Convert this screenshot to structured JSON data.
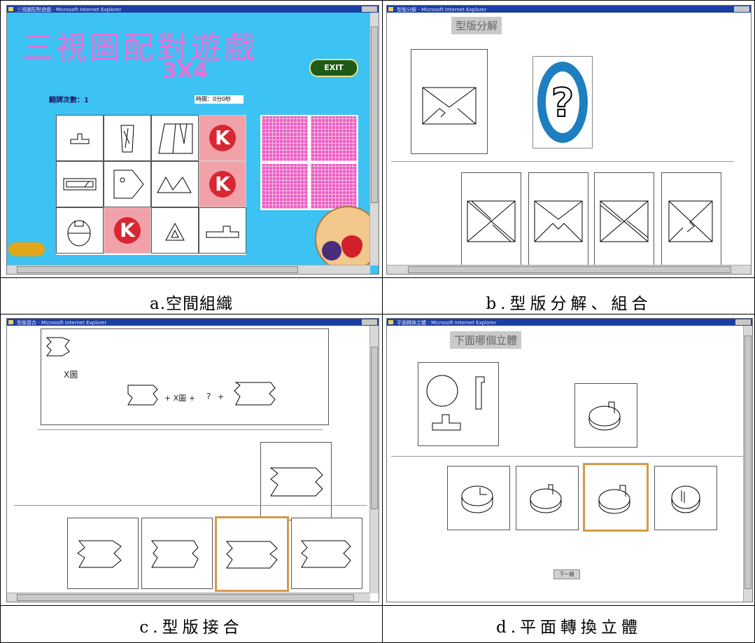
{
  "panel_a": {
    "window_title": "三視圖配對遊戲 - Microsoft Internet Explorer",
    "game_title": "三視圖配對遊戲",
    "grid_size": "3X4",
    "exit_label": "EXIT",
    "flip_count_label": "翻牌次數：1",
    "timer_label": "時間：0分0秒",
    "k_glyph": "K",
    "caption": "a.空間組織"
  },
  "panel_b": {
    "window_title": "型版分解 - Microsoft Internet Explorer",
    "header_label": "型版分解",
    "question_glyph": "?",
    "caption": "b.型版分解、組合"
  },
  "panel_c": {
    "window_title": "型版接合 - Microsoft Internet Explorer",
    "x_label": "X圖",
    "equation_plus_x": "+ X圖 +",
    "equation_q": "?",
    "equation_plus": "+",
    "caption": "c.型版接合"
  },
  "panel_d": {
    "window_title": "平面轉換立體 - Microsoft Internet Explorer",
    "header_label": "下面哪個立體",
    "next_button": "下一題",
    "caption": "d.平面轉換立體"
  },
  "colors": {
    "game_bg": "#3cc2f3",
    "game_title": "#e86fd6",
    "pink_card": "#ec5fc4",
    "selected_border": "#d49a4a",
    "question_ring": "#1e7fc0"
  }
}
